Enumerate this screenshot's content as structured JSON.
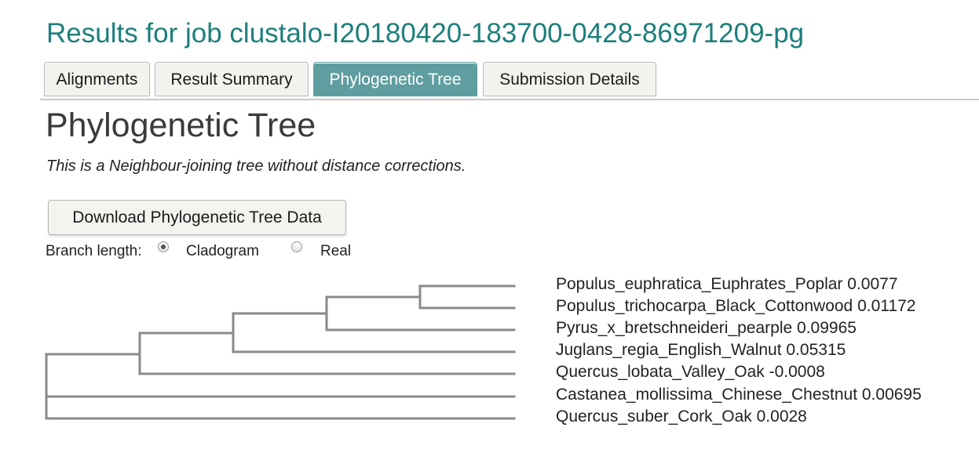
{
  "header": {
    "job_title": "Results for job clustalo-I20180420-183700-0428-86971209-pg"
  },
  "tabs": [
    {
      "label": "Alignments",
      "active": false
    },
    {
      "label": "Result Summary",
      "active": false
    },
    {
      "label": "Phylogenetic Tree",
      "active": true
    },
    {
      "label": "Submission Details",
      "active": false
    }
  ],
  "section": {
    "title": "Phylogenetic Tree",
    "description": "This is a Neighbour-joining tree without distance corrections."
  },
  "download": {
    "label": "Download Phylogenetic Tree Data"
  },
  "branch_length": {
    "label": "Branch length:",
    "options": [
      {
        "label": "Cladogram",
        "checked": true
      },
      {
        "label": "Real",
        "checked": false
      }
    ]
  },
  "tree": {
    "line_color": "#8a8a8a",
    "leaves": [
      "Populus_euphratica_Euphrates_Poplar 0.0077",
      "Populus_trichocarpa_Black_Cottonwood 0.01172",
      "Pyrus_x_bretschneideri_pearple 0.09965",
      "Juglans_regia_English_Walnut 0.05315",
      "Quercus_lobata_Valley_Oak -0.0008",
      "Castanea_mollissima_Chinese_Chestnut 0.00695",
      "Quercus_suber_Cork_Oak 0.0028"
    ]
  },
  "colors": {
    "title": "#1d7f7c",
    "active_tab": "#5f9ea0"
  }
}
